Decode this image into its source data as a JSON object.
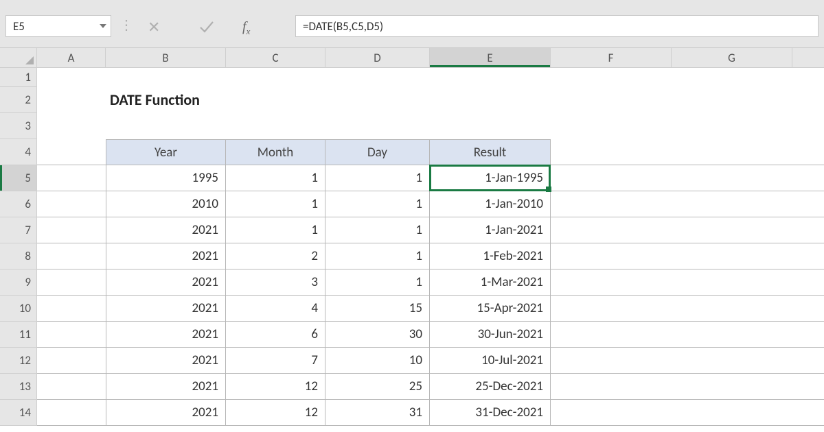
{
  "name_box": "E5",
  "formula": "=DATE(B5,C5,D5)",
  "columns": [
    "A",
    "B",
    "C",
    "D",
    "E",
    "F",
    "G"
  ],
  "active_column": "E",
  "row_labels": [
    1,
    2,
    3,
    4,
    5,
    6,
    7,
    8,
    9,
    10,
    11,
    12,
    13,
    14
  ],
  "active_row": 5,
  "title": "DATE Function",
  "headers": {
    "year": "Year",
    "month": "Month",
    "day": "Day",
    "result": "Result"
  },
  "data_rows": [
    {
      "year": 1995,
      "month": 1,
      "day": 1,
      "result": "1-Jan-1995"
    },
    {
      "year": 2010,
      "month": 1,
      "day": 1,
      "result": "1-Jan-2010"
    },
    {
      "year": 2021,
      "month": 1,
      "day": 1,
      "result": "1-Jan-2021"
    },
    {
      "year": 2021,
      "month": 2,
      "day": 1,
      "result": "1-Feb-2021"
    },
    {
      "year": 2021,
      "month": 3,
      "day": 1,
      "result": "1-Mar-2021"
    },
    {
      "year": 2021,
      "month": 4,
      "day": 15,
      "result": "15-Apr-2021"
    },
    {
      "year": 2021,
      "month": 6,
      "day": 30,
      "result": "30-Jun-2021"
    },
    {
      "year": 2021,
      "month": 7,
      "day": 10,
      "result": "10-Jul-2021"
    },
    {
      "year": 2021,
      "month": 12,
      "day": 25,
      "result": "25-Dec-2021"
    },
    {
      "year": 2021,
      "month": 12,
      "day": 31,
      "result": "31-Dec-2021"
    }
  ]
}
